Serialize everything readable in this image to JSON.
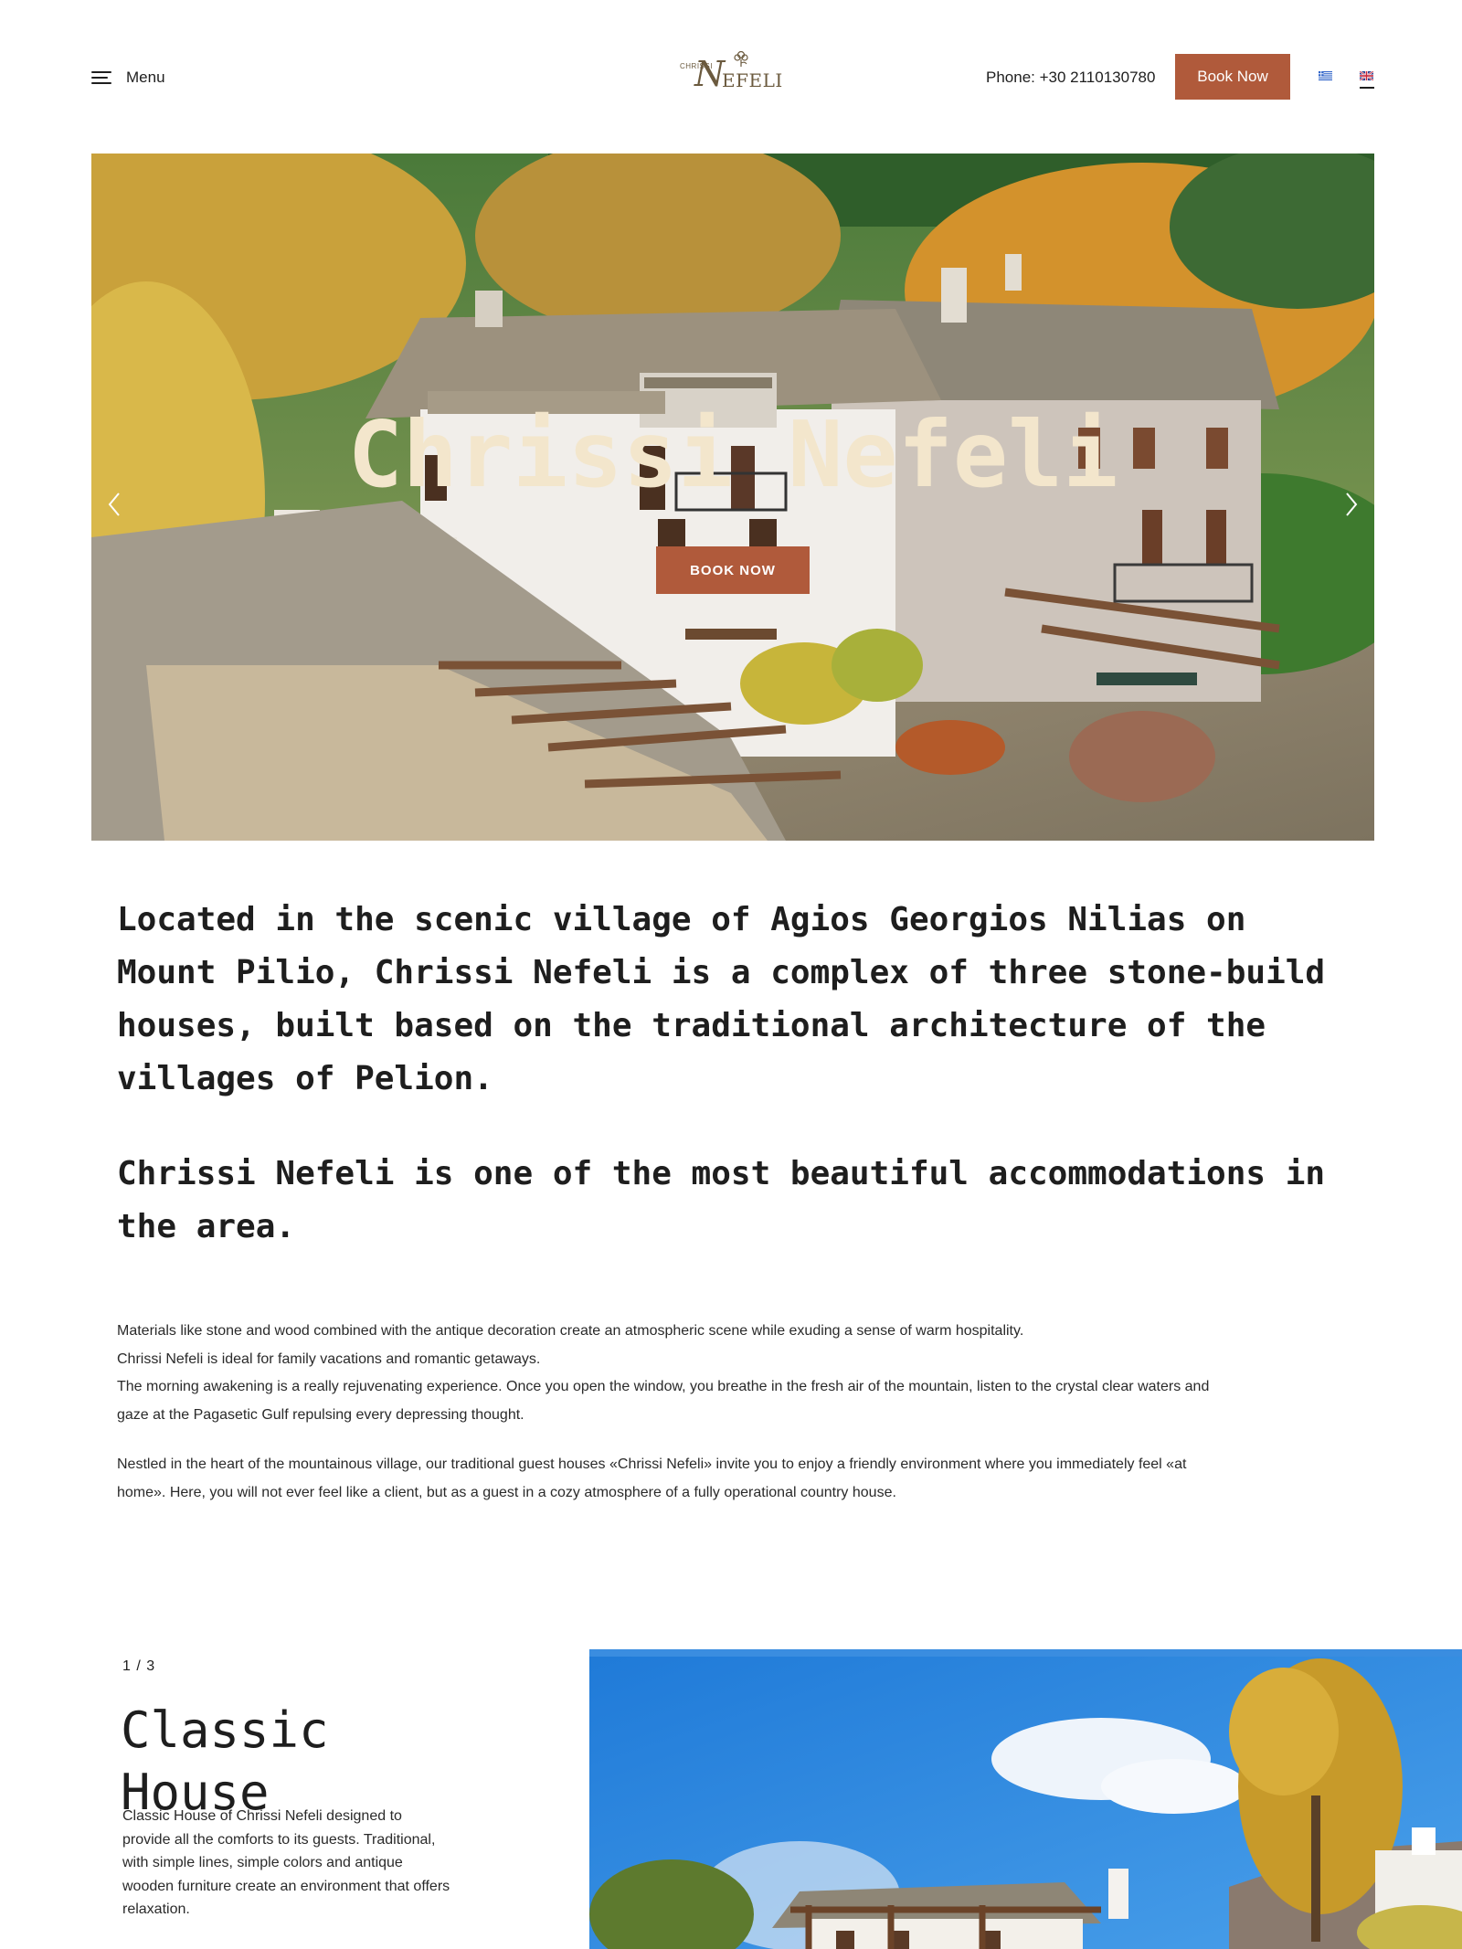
{
  "header": {
    "menu_label": "Menu",
    "logo": {
      "small_text": "CHRISSI",
      "script_letter": "N",
      "rest_text": "EFELI"
    },
    "phone": "Phone: +30 2110130780",
    "book_now": "Book Now",
    "languages": [
      "greek-flag",
      "uk-flag"
    ]
  },
  "hero": {
    "title": "Chrissi Nefeli",
    "button": "BOOK NOW"
  },
  "intro": {
    "lead_1": "Located in the scenic village of Agios Georgios Nilias on Mount Pilio, Chrissi Nefeli is a complex of three stone-build houses, built based on the traditional architecture of the villages of Pelion.",
    "lead_2": "Chrissi Nefeli is one of the most beautiful accommodations in the area.",
    "para_1_line_1": "Materials like stone and wood combined with the antique decoration create an atmospheric scene while exuding a sense of warm hospitality.",
    "para_1_line_2": "Chrissi Nefeli is ideal for family vacations and romantic getaways.",
    "para_1_line_3": "The morning awakening is a really rejuvenating experience. Once you open the window, you breathe in the fresh air of the mountain, listen to the crystal clear waters and gaze at the Pagasetic Gulf repulsing every depressing thought.",
    "para_2": "Nestled in the heart of the mountainous village, our traditional guest houses «Chrissi Nefeli» invite you to enjoy a friendly environment where you immediately feel «at home». Here, you will not ever feel like a client, but as a guest in a cozy atmosphere of a fully operational country house."
  },
  "rooms": {
    "counter": "1  /  3",
    "title": "Classic House",
    "description": "Classic House of Chrissi Nefeli designed to provide all the comforts to its guests. Traditional, with simple lines, simple colors and antique wooden furniture create an environment that offers relaxation."
  },
  "colors": {
    "accent": "#b05a3b",
    "hero_title": "#f3e6cc",
    "logo": "#6b5a3e",
    "text": "#1e1e1e"
  }
}
